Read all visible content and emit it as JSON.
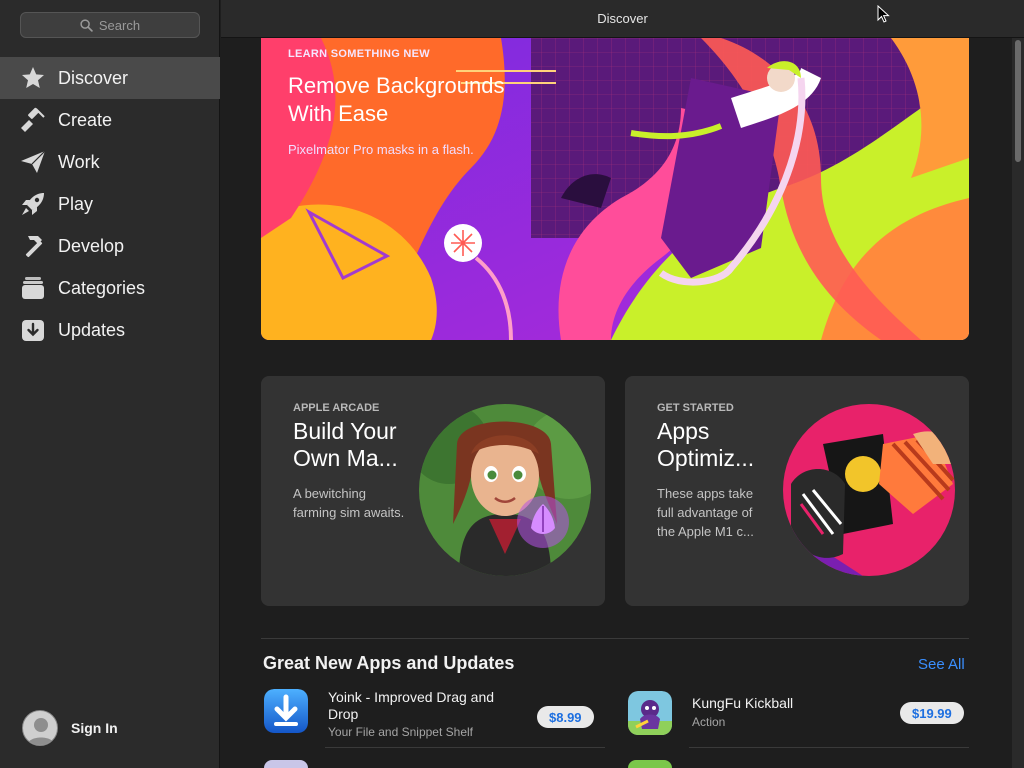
{
  "window": {
    "title": "Discover"
  },
  "search": {
    "placeholder": "Search"
  },
  "sidebar": {
    "items": [
      {
        "label": "Discover",
        "icon": "star-icon",
        "active": true
      },
      {
        "label": "Create",
        "icon": "brush-icon",
        "active": false
      },
      {
        "label": "Work",
        "icon": "paper-plane-icon",
        "active": false
      },
      {
        "label": "Play",
        "icon": "rocket-icon",
        "active": false
      },
      {
        "label": "Develop",
        "icon": "hammer-icon",
        "active": false
      },
      {
        "label": "Categories",
        "icon": "stack-icon",
        "active": false
      },
      {
        "label": "Updates",
        "icon": "download-icon",
        "active": false
      }
    ],
    "sign_in": "Sign In"
  },
  "hero": {
    "eyebrow": "LEARN SOMETHING NEW",
    "title": "Remove Backgrounds With Ease",
    "subtitle": "Pixelmator Pro masks in a flash."
  },
  "cards": [
    {
      "eyebrow": "APPLE ARCADE",
      "title": "Build Your Own Ma...",
      "subtitle": "A bewitching farming sim awaits."
    },
    {
      "eyebrow": "GET STARTED",
      "title": "Apps Optimiz...",
      "subtitle": "These apps take full advantage of the Apple M1 c..."
    }
  ],
  "section": {
    "title": "Great New Apps and Updates",
    "see_all": "See All"
  },
  "apps": [
    {
      "name": "Yoink - Improved Drag and Drop",
      "subtitle": "Your File and Snippet Shelf",
      "price": "$8.99"
    },
    {
      "name": "KungFu Kickball",
      "subtitle": "Action",
      "price": "$19.99"
    }
  ],
  "colors": {
    "accent": "#3a8fff",
    "sidebar": "#2b2b2b",
    "active_item": "#4a4a4a"
  }
}
